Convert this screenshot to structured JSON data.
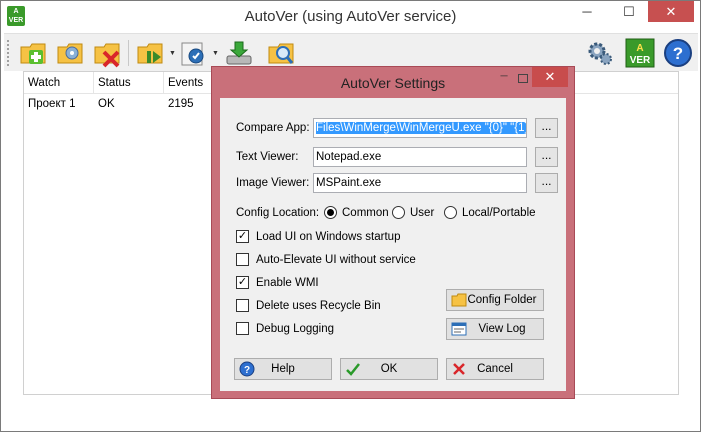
{
  "window": {
    "title": "AutoVer (using AutoVer service)",
    "minimize": "─",
    "maximize": "☐",
    "close": "✕"
  },
  "app_icon": {
    "line1": "A",
    "line2": "VER"
  },
  "toolbar": {
    "icons": [
      "add-watch-icon",
      "edit-watch-icon",
      "delete-watch-icon",
      "pause-resume-icon",
      "settings-wizard-icon",
      "backup-restore-icon",
      "search-icon",
      "options-gear-icon",
      "autover-logo-icon",
      "help-icon"
    ]
  },
  "list": {
    "columns": [
      "Watch",
      "Status",
      "Events"
    ],
    "rows": [
      {
        "watch": "Проект 1",
        "status": "OK",
        "events": "2195"
      }
    ]
  },
  "dialog": {
    "title": "AutoVer Settings",
    "minimize": "─",
    "close": "✕",
    "compare_app": {
      "label": "Compare App:",
      "value": "Files\\WinMerge\\WinMergeU.exe \"{0}\" \"{1}\""
    },
    "text_viewer": {
      "label": "Text Viewer:",
      "value": "Notepad.exe"
    },
    "image_viewer": {
      "label": "Image Viewer:",
      "value": "MSPaint.exe"
    },
    "browse_label": "...",
    "config_location": {
      "label": "Config Location:",
      "options": [
        "Common",
        "User",
        "Local/Portable"
      ],
      "selected": "Common"
    },
    "checkboxes": [
      {
        "label": "Load UI on Windows startup",
        "checked": true
      },
      {
        "label": "Auto-Elevate UI without service",
        "checked": false
      },
      {
        "label": "Enable WMI",
        "checked": true
      },
      {
        "label": "Delete uses Recycle Bin",
        "checked": false
      },
      {
        "label": "Debug Logging",
        "checked": false
      }
    ],
    "config_folder_button": "Config Folder",
    "view_log_button": "View Log",
    "help_button": "Help",
    "ok_button": "OK",
    "cancel_button": "Cancel",
    "check_mark": "✓"
  },
  "colors": {
    "dialog_frame": "#c9707a",
    "close_red": "#c84c4c",
    "selection_blue": "#3399ff"
  }
}
